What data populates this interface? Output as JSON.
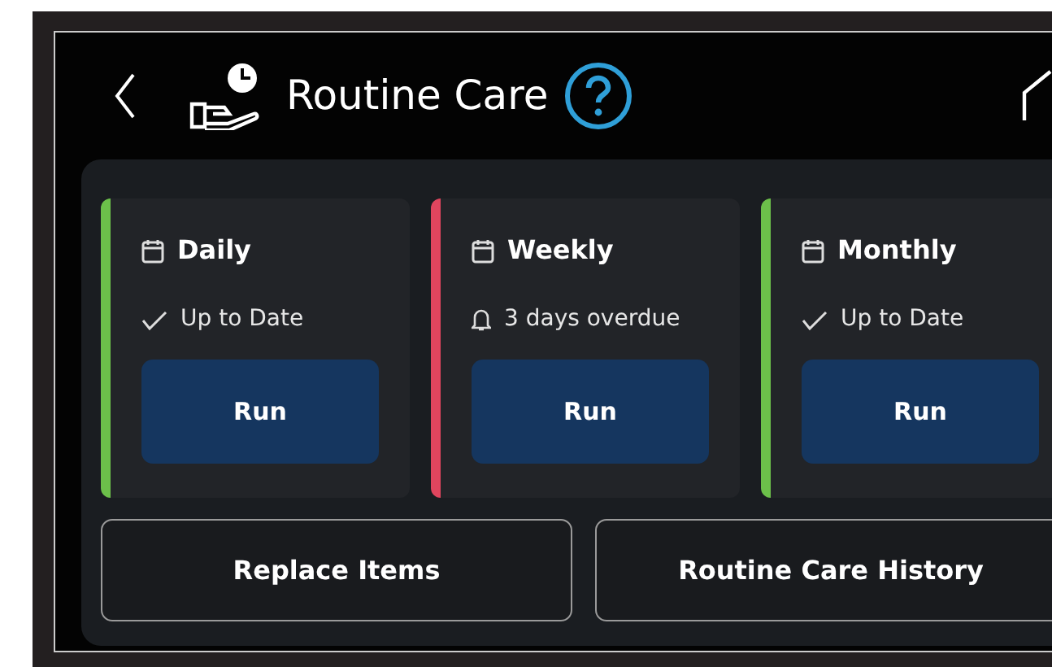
{
  "header": {
    "title": "Routine Care"
  },
  "schedules": [
    {
      "title": "Daily",
      "status": "Up to Date",
      "kind": "ok",
      "color": "#6cc04a"
    },
    {
      "title": "Weekly",
      "status": "3 days overdue",
      "kind": "overdue",
      "color": "#e0455e"
    },
    {
      "title": "Monthly",
      "status": "Up to Date",
      "kind": "ok",
      "color": "#6cc04a"
    }
  ],
  "run_label": [
    "Run",
    "Run",
    "Run"
  ],
  "actions": [
    "Replace Items",
    "Routine Care History"
  ]
}
